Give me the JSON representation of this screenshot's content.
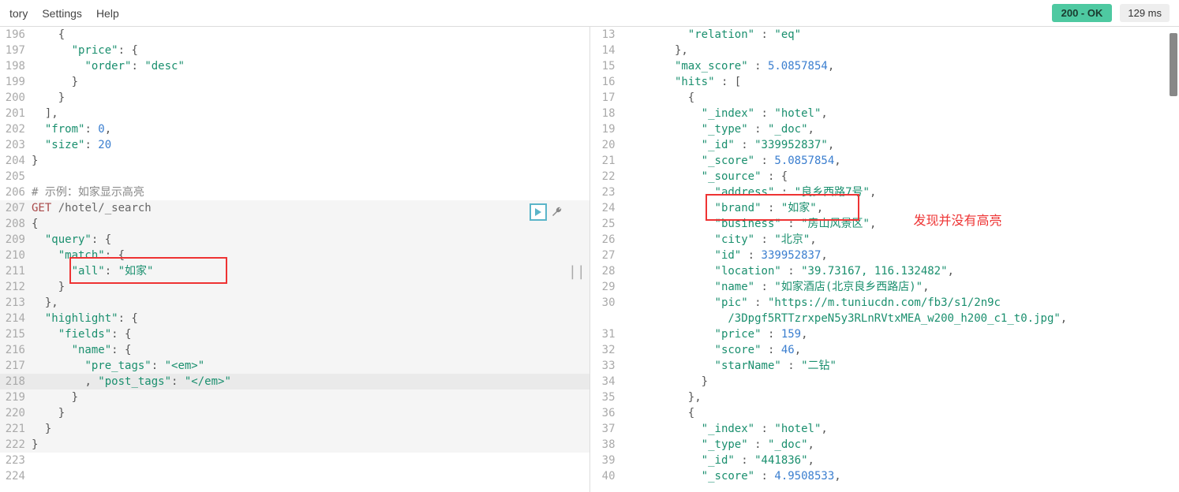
{
  "topbar": {
    "items": [
      "tory",
      "Settings",
      "Help"
    ],
    "status": "200 - OK",
    "time": "129 ms"
  },
  "left": {
    "lines": [
      {
        "n": "196",
        "indent": "    ",
        "tokens": [
          {
            "t": "{",
            "c": "punct"
          }
        ]
      },
      {
        "n": "197",
        "indent": "      ",
        "tokens": [
          {
            "t": "\"price\"",
            "c": "key"
          },
          {
            "t": ": {",
            "c": "punct"
          }
        ]
      },
      {
        "n": "198",
        "indent": "        ",
        "tokens": [
          {
            "t": "\"order\"",
            "c": "key"
          },
          {
            "t": ": ",
            "c": "punct"
          },
          {
            "t": "\"desc\"",
            "c": "str"
          }
        ]
      },
      {
        "n": "199",
        "indent": "      ",
        "tokens": [
          {
            "t": "}",
            "c": "punct"
          }
        ]
      },
      {
        "n": "200",
        "indent": "    ",
        "tokens": [
          {
            "t": "}",
            "c": "punct"
          }
        ]
      },
      {
        "n": "201",
        "indent": "  ",
        "tokens": [
          {
            "t": "],",
            "c": "punct"
          }
        ]
      },
      {
        "n": "202",
        "indent": "  ",
        "tokens": [
          {
            "t": "\"from\"",
            "c": "key"
          },
          {
            "t": ": ",
            "c": "punct"
          },
          {
            "t": "0",
            "c": "num"
          },
          {
            "t": ",",
            "c": "punct"
          }
        ]
      },
      {
        "n": "203",
        "indent": "  ",
        "tokens": [
          {
            "t": "\"size\"",
            "c": "key"
          },
          {
            "t": ": ",
            "c": "punct"
          },
          {
            "t": "20",
            "c": "num"
          }
        ]
      },
      {
        "n": "204",
        "indent": "",
        "tokens": [
          {
            "t": "}",
            "c": "punct"
          }
        ]
      },
      {
        "n": "205",
        "indent": "",
        "tokens": []
      },
      {
        "n": "206",
        "indent": "",
        "tokens": [
          {
            "t": "# 示例：如家显示高亮",
            "c": "comment"
          }
        ]
      },
      {
        "n": "207",
        "indent": "",
        "tokens": [
          {
            "t": "GET",
            "c": "method"
          },
          {
            "t": " ",
            "c": ""
          },
          {
            "t": "/hotel/_search",
            "c": "path"
          }
        ],
        "active": true
      },
      {
        "n": "208",
        "indent": "",
        "tokens": [
          {
            "t": "{",
            "c": "punct"
          }
        ],
        "active": true
      },
      {
        "n": "209",
        "indent": "  ",
        "tokens": [
          {
            "t": "\"query\"",
            "c": "key"
          },
          {
            "t": ": {",
            "c": "punct"
          }
        ],
        "active": true
      },
      {
        "n": "210",
        "indent": "    ",
        "tokens": [
          {
            "t": "\"match\"",
            "c": "key"
          },
          {
            "t": ": {",
            "c": "punct"
          }
        ],
        "active": true
      },
      {
        "n": "211",
        "indent": "      ",
        "tokens": [
          {
            "t": "\"all\"",
            "c": "key"
          },
          {
            "t": ": ",
            "c": "punct"
          },
          {
            "t": "\"如家\"",
            "c": "str"
          }
        ],
        "active": true
      },
      {
        "n": "212",
        "indent": "    ",
        "tokens": [
          {
            "t": "}",
            "c": "punct"
          }
        ],
        "active": true
      },
      {
        "n": "213",
        "indent": "  ",
        "tokens": [
          {
            "t": "},",
            "c": "punct"
          }
        ],
        "active": true
      },
      {
        "n": "214",
        "indent": "  ",
        "tokens": [
          {
            "t": "\"highlight\"",
            "c": "key"
          },
          {
            "t": ": {",
            "c": "punct"
          }
        ],
        "active": true
      },
      {
        "n": "215",
        "indent": "    ",
        "tokens": [
          {
            "t": "\"fields\"",
            "c": "key"
          },
          {
            "t": ": {",
            "c": "punct"
          }
        ],
        "active": true
      },
      {
        "n": "216",
        "indent": "      ",
        "tokens": [
          {
            "t": "\"name\"",
            "c": "key"
          },
          {
            "t": ": {",
            "c": "punct"
          }
        ],
        "active": true
      },
      {
        "n": "217",
        "indent": "        ",
        "tokens": [
          {
            "t": "\"pre_tags\"",
            "c": "key"
          },
          {
            "t": ": ",
            "c": "punct"
          },
          {
            "t": "\"<em>\"",
            "c": "str"
          }
        ],
        "active": true
      },
      {
        "n": "218",
        "indent": "        ",
        "tokens": [
          {
            "t": ", ",
            "c": "punct"
          },
          {
            "t": "\"post_tags\"",
            "c": "key"
          },
          {
            "t": ": ",
            "c": "punct"
          },
          {
            "t": "\"</em>\"",
            "c": "str"
          }
        ],
        "active": true,
        "current": true
      },
      {
        "n": "219",
        "indent": "      ",
        "tokens": [
          {
            "t": "}",
            "c": "punct"
          }
        ],
        "active": true
      },
      {
        "n": "220",
        "indent": "    ",
        "tokens": [
          {
            "t": "}",
            "c": "punct"
          }
        ],
        "active": true
      },
      {
        "n": "221",
        "indent": "  ",
        "tokens": [
          {
            "t": "}",
            "c": "punct"
          }
        ],
        "active": true
      },
      {
        "n": "222",
        "indent": "",
        "tokens": [
          {
            "t": "}",
            "c": "punct"
          }
        ],
        "active": true
      },
      {
        "n": "223",
        "indent": "",
        "tokens": []
      },
      {
        "n": "224",
        "indent": "",
        "tokens": []
      }
    ]
  },
  "right": {
    "lines": [
      {
        "n": "13",
        "indent": "          ",
        "tokens": [
          {
            "t": "\"relation\"",
            "c": "key"
          },
          {
            "t": " : ",
            "c": "punct"
          },
          {
            "t": "\"eq\"",
            "c": "str"
          }
        ]
      },
      {
        "n": "14",
        "indent": "        ",
        "tokens": [
          {
            "t": "},",
            "c": "punct"
          }
        ]
      },
      {
        "n": "15",
        "indent": "        ",
        "tokens": [
          {
            "t": "\"max_score\"",
            "c": "key"
          },
          {
            "t": " : ",
            "c": "punct"
          },
          {
            "t": "5.0857854",
            "c": "num"
          },
          {
            "t": ",",
            "c": "punct"
          }
        ]
      },
      {
        "n": "16",
        "indent": "        ",
        "tokens": [
          {
            "t": "\"hits\"",
            "c": "key"
          },
          {
            "t": " : [",
            "c": "punct"
          }
        ]
      },
      {
        "n": "17",
        "indent": "          ",
        "tokens": [
          {
            "t": "{",
            "c": "punct"
          }
        ]
      },
      {
        "n": "18",
        "indent": "            ",
        "tokens": [
          {
            "t": "\"_index\"",
            "c": "key"
          },
          {
            "t": " : ",
            "c": "punct"
          },
          {
            "t": "\"hotel\"",
            "c": "str"
          },
          {
            "t": ",",
            "c": "punct"
          }
        ]
      },
      {
        "n": "19",
        "indent": "            ",
        "tokens": [
          {
            "t": "\"_type\"",
            "c": "key"
          },
          {
            "t": " : ",
            "c": "punct"
          },
          {
            "t": "\"_doc\"",
            "c": "str"
          },
          {
            "t": ",",
            "c": "punct"
          }
        ]
      },
      {
        "n": "20",
        "indent": "            ",
        "tokens": [
          {
            "t": "\"_id\"",
            "c": "key"
          },
          {
            "t": " : ",
            "c": "punct"
          },
          {
            "t": "\"339952837\"",
            "c": "str"
          },
          {
            "t": ",",
            "c": "punct"
          }
        ]
      },
      {
        "n": "21",
        "indent": "            ",
        "tokens": [
          {
            "t": "\"_score\"",
            "c": "key"
          },
          {
            "t": " : ",
            "c": "punct"
          },
          {
            "t": "5.0857854",
            "c": "num"
          },
          {
            "t": ",",
            "c": "punct"
          }
        ]
      },
      {
        "n": "22",
        "indent": "            ",
        "tokens": [
          {
            "t": "\"_source\"",
            "c": "key"
          },
          {
            "t": " : {",
            "c": "punct"
          }
        ]
      },
      {
        "n": "23",
        "indent": "              ",
        "tokens": [
          {
            "t": "\"address\"",
            "c": "key"
          },
          {
            "t": " : ",
            "c": "punct"
          },
          {
            "t": "\"良乡西路7号\"",
            "c": "str"
          },
          {
            "t": ",",
            "c": "punct"
          }
        ]
      },
      {
        "n": "24",
        "indent": "              ",
        "tokens": [
          {
            "t": "\"brand\"",
            "c": "key"
          },
          {
            "t": " : ",
            "c": "punct"
          },
          {
            "t": "\"如家\"",
            "c": "str"
          },
          {
            "t": ",",
            "c": "punct"
          }
        ]
      },
      {
        "n": "25",
        "indent": "              ",
        "tokens": [
          {
            "t": "\"business\"",
            "c": "key"
          },
          {
            "t": " : ",
            "c": "punct"
          },
          {
            "t": "\"房山风景区\"",
            "c": "str"
          },
          {
            "t": ",",
            "c": "punct"
          }
        ]
      },
      {
        "n": "26",
        "indent": "              ",
        "tokens": [
          {
            "t": "\"city\"",
            "c": "key"
          },
          {
            "t": " : ",
            "c": "punct"
          },
          {
            "t": "\"北京\"",
            "c": "str"
          },
          {
            "t": ",",
            "c": "punct"
          }
        ]
      },
      {
        "n": "27",
        "indent": "              ",
        "tokens": [
          {
            "t": "\"id\"",
            "c": "key"
          },
          {
            "t": " : ",
            "c": "punct"
          },
          {
            "t": "339952837",
            "c": "num"
          },
          {
            "t": ",",
            "c": "punct"
          }
        ]
      },
      {
        "n": "28",
        "indent": "              ",
        "tokens": [
          {
            "t": "\"location\"",
            "c": "key"
          },
          {
            "t": " : ",
            "c": "punct"
          },
          {
            "t": "\"39.73167, 116.132482\"",
            "c": "str"
          },
          {
            "t": ",",
            "c": "punct"
          }
        ]
      },
      {
        "n": "29",
        "indent": "              ",
        "tokens": [
          {
            "t": "\"name\"",
            "c": "key"
          },
          {
            "t": " : ",
            "c": "punct"
          },
          {
            "t": "\"如家酒店(北京良乡西路店)\"",
            "c": "str"
          },
          {
            "t": ",",
            "c": "punct"
          }
        ]
      },
      {
        "n": "30",
        "indent": "              ",
        "tokens": [
          {
            "t": "\"pic\"",
            "c": "key"
          },
          {
            "t": " : ",
            "c": "punct"
          },
          {
            "t": "\"https://m.tuniucdn.com/fb3/s1/2n9c",
            "c": "str"
          }
        ]
      },
      {
        "n": "",
        "indent": "                ",
        "tokens": [
          {
            "t": "/3Dpgf5RTTzrxpeN5y3RLnRVtxMEA_w200_h200_c1_t0.jpg\"",
            "c": "str"
          },
          {
            "t": ",",
            "c": "punct"
          }
        ]
      },
      {
        "n": "31",
        "indent": "              ",
        "tokens": [
          {
            "t": "\"price\"",
            "c": "key"
          },
          {
            "t": " : ",
            "c": "punct"
          },
          {
            "t": "159",
            "c": "num"
          },
          {
            "t": ",",
            "c": "punct"
          }
        ]
      },
      {
        "n": "32",
        "indent": "              ",
        "tokens": [
          {
            "t": "\"score\"",
            "c": "key"
          },
          {
            "t": " : ",
            "c": "punct"
          },
          {
            "t": "46",
            "c": "num"
          },
          {
            "t": ",",
            "c": "punct"
          }
        ]
      },
      {
        "n": "33",
        "indent": "              ",
        "tokens": [
          {
            "t": "\"starName\"",
            "c": "key"
          },
          {
            "t": " : ",
            "c": "punct"
          },
          {
            "t": "\"二钻\"",
            "c": "str"
          }
        ]
      },
      {
        "n": "34",
        "indent": "            ",
        "tokens": [
          {
            "t": "}",
            "c": "punct"
          }
        ]
      },
      {
        "n": "35",
        "indent": "          ",
        "tokens": [
          {
            "t": "},",
            "c": "punct"
          }
        ]
      },
      {
        "n": "36",
        "indent": "          ",
        "tokens": [
          {
            "t": "{",
            "c": "punct"
          }
        ]
      },
      {
        "n": "37",
        "indent": "            ",
        "tokens": [
          {
            "t": "\"_index\"",
            "c": "key"
          },
          {
            "t": " : ",
            "c": "punct"
          },
          {
            "t": "\"hotel\"",
            "c": "str"
          },
          {
            "t": ",",
            "c": "punct"
          }
        ]
      },
      {
        "n": "38",
        "indent": "            ",
        "tokens": [
          {
            "t": "\"_type\"",
            "c": "key"
          },
          {
            "t": " : ",
            "c": "punct"
          },
          {
            "t": "\"_doc\"",
            "c": "str"
          },
          {
            "t": ",",
            "c": "punct"
          }
        ]
      },
      {
        "n": "39",
        "indent": "            ",
        "tokens": [
          {
            "t": "\"_id\"",
            "c": "key"
          },
          {
            "t": " : ",
            "c": "punct"
          },
          {
            "t": "\"441836\"",
            "c": "str"
          },
          {
            "t": ",",
            "c": "punct"
          }
        ]
      },
      {
        "n": "40",
        "indent": "            ",
        "tokens": [
          {
            "t": "\"_score\"",
            "c": "key"
          },
          {
            "t": " : ",
            "c": "punct"
          },
          {
            "t": "4.9508533",
            "c": "num"
          },
          {
            "t": ",",
            "c": "punct"
          }
        ]
      }
    ]
  },
  "annotations": {
    "redText": "发现并没有高亮"
  }
}
